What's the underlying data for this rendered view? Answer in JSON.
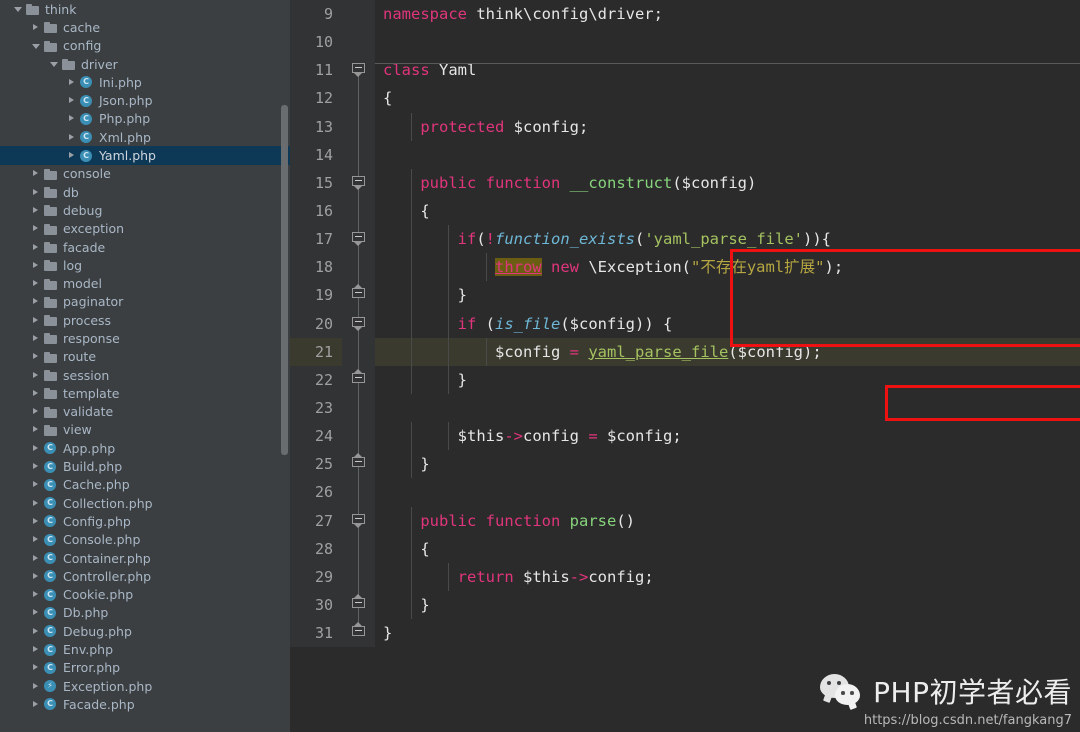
{
  "sidebar": {
    "scrollbar": "vertical-scrollbar",
    "items": [
      {
        "label": "think",
        "depth": 1,
        "type": "folder",
        "arrow": "open",
        "selected": false
      },
      {
        "label": "cache",
        "depth": 2,
        "type": "folder",
        "arrow": "closed",
        "selected": false
      },
      {
        "label": "config",
        "depth": 2,
        "type": "folder",
        "arrow": "open",
        "selected": false
      },
      {
        "label": "driver",
        "depth": 3,
        "type": "folder",
        "arrow": "open",
        "selected": false
      },
      {
        "label": "Ini.php",
        "depth": 4,
        "type": "class",
        "arrow": "closed",
        "selected": false
      },
      {
        "label": "Json.php",
        "depth": 4,
        "type": "class",
        "arrow": "closed",
        "selected": false
      },
      {
        "label": "Php.php",
        "depth": 4,
        "type": "class",
        "arrow": "closed",
        "selected": false
      },
      {
        "label": "Xml.php",
        "depth": 4,
        "type": "class",
        "arrow": "closed",
        "selected": false
      },
      {
        "label": "Yaml.php",
        "depth": 4,
        "type": "class",
        "arrow": "closed",
        "selected": true
      },
      {
        "label": "console",
        "depth": 2,
        "type": "folder",
        "arrow": "closed",
        "selected": false
      },
      {
        "label": "db",
        "depth": 2,
        "type": "folder",
        "arrow": "closed",
        "selected": false
      },
      {
        "label": "debug",
        "depth": 2,
        "type": "folder",
        "arrow": "closed",
        "selected": false
      },
      {
        "label": "exception",
        "depth": 2,
        "type": "folder",
        "arrow": "closed",
        "selected": false
      },
      {
        "label": "facade",
        "depth": 2,
        "type": "folder",
        "arrow": "closed",
        "selected": false
      },
      {
        "label": "log",
        "depth": 2,
        "type": "folder",
        "arrow": "closed",
        "selected": false
      },
      {
        "label": "model",
        "depth": 2,
        "type": "folder",
        "arrow": "closed",
        "selected": false
      },
      {
        "label": "paginator",
        "depth": 2,
        "type": "folder",
        "arrow": "closed",
        "selected": false
      },
      {
        "label": "process",
        "depth": 2,
        "type": "folder",
        "arrow": "closed",
        "selected": false
      },
      {
        "label": "response",
        "depth": 2,
        "type": "folder",
        "arrow": "closed",
        "selected": false
      },
      {
        "label": "route",
        "depth": 2,
        "type": "folder",
        "arrow": "closed",
        "selected": false
      },
      {
        "label": "session",
        "depth": 2,
        "type": "folder",
        "arrow": "closed",
        "selected": false
      },
      {
        "label": "template",
        "depth": 2,
        "type": "folder",
        "arrow": "closed",
        "selected": false
      },
      {
        "label": "validate",
        "depth": 2,
        "type": "folder",
        "arrow": "closed",
        "selected": false
      },
      {
        "label": "view",
        "depth": 2,
        "type": "folder",
        "arrow": "closed",
        "selected": false
      },
      {
        "label": "App.php",
        "depth": 2,
        "type": "class",
        "arrow": "closed",
        "selected": false
      },
      {
        "label": "Build.php",
        "depth": 2,
        "type": "class",
        "arrow": "closed",
        "selected": false
      },
      {
        "label": "Cache.php",
        "depth": 2,
        "type": "class",
        "arrow": "closed",
        "selected": false
      },
      {
        "label": "Collection.php",
        "depth": 2,
        "type": "class",
        "arrow": "closed",
        "selected": false
      },
      {
        "label": "Config.php",
        "depth": 2,
        "type": "class",
        "arrow": "closed",
        "selected": false
      },
      {
        "label": "Console.php",
        "depth": 2,
        "type": "class",
        "arrow": "closed",
        "selected": false
      },
      {
        "label": "Container.php",
        "depth": 2,
        "type": "class",
        "arrow": "closed",
        "selected": false
      },
      {
        "label": "Controller.php",
        "depth": 2,
        "type": "class",
        "arrow": "closed",
        "selected": false
      },
      {
        "label": "Cookie.php",
        "depth": 2,
        "type": "class",
        "arrow": "closed",
        "selected": false
      },
      {
        "label": "Db.php",
        "depth": 2,
        "type": "class",
        "arrow": "closed",
        "selected": false
      },
      {
        "label": "Debug.php",
        "depth": 2,
        "type": "class",
        "arrow": "closed",
        "selected": false
      },
      {
        "label": "Env.php",
        "depth": 2,
        "type": "class",
        "arrow": "closed",
        "selected": false
      },
      {
        "label": "Error.php",
        "depth": 2,
        "type": "class",
        "arrow": "closed",
        "selected": false
      },
      {
        "label": "Exception.php",
        "depth": 2,
        "type": "exception",
        "arrow": "closed",
        "selected": false
      },
      {
        "label": "Facade.php",
        "depth": 2,
        "type": "class",
        "arrow": "closed",
        "selected": false
      }
    ]
  },
  "editor": {
    "current_line": 21,
    "lines": [
      {
        "num": "9",
        "fold": "none",
        "vline": "none",
        "text": "namespace think\\config\\driver;"
      },
      {
        "num": "10",
        "fold": "none",
        "vline": "none",
        "text": ""
      },
      {
        "num": "11",
        "fold": "down",
        "vline": "half-bot",
        "text": "class Yaml"
      },
      {
        "num": "12",
        "fold": "none",
        "vline": "full",
        "text": "{"
      },
      {
        "num": "13",
        "fold": "none",
        "vline": "full",
        "text": "    protected $config;"
      },
      {
        "num": "14",
        "fold": "none",
        "vline": "full",
        "text": ""
      },
      {
        "num": "15",
        "fold": "down",
        "vline": "full",
        "text": "    public function __construct($config)"
      },
      {
        "num": "16",
        "fold": "none",
        "vline": "full",
        "text": "    {"
      },
      {
        "num": "17",
        "fold": "down",
        "vline": "full",
        "text": "        if(!function_exists('yaml_parse_file')){"
      },
      {
        "num": "18",
        "fold": "none",
        "vline": "full",
        "text": "            throw new \\Exception(\"不存在yaml扩展\");"
      },
      {
        "num": "19",
        "fold": "up",
        "vline": "full",
        "text": "        }"
      },
      {
        "num": "20",
        "fold": "down",
        "vline": "full",
        "text": "        if (is_file($config)) {"
      },
      {
        "num": "21",
        "fold": "none",
        "vline": "full",
        "text": "            $config = yaml_parse_file($config);"
      },
      {
        "num": "22",
        "fold": "up",
        "vline": "full",
        "text": "        }"
      },
      {
        "num": "23",
        "fold": "none",
        "vline": "full",
        "text": ""
      },
      {
        "num": "24",
        "fold": "none",
        "vline": "full",
        "text": "        $this->config = $config;"
      },
      {
        "num": "25",
        "fold": "up",
        "vline": "full",
        "text": "    }"
      },
      {
        "num": "26",
        "fold": "none",
        "vline": "full",
        "text": ""
      },
      {
        "num": "27",
        "fold": "down",
        "vline": "full",
        "text": "    public function parse()"
      },
      {
        "num": "28",
        "fold": "none",
        "vline": "full",
        "text": "    {"
      },
      {
        "num": "29",
        "fold": "none",
        "vline": "full",
        "text": "        return $this->config;"
      },
      {
        "num": "30",
        "fold": "up",
        "vline": "full",
        "text": "    }"
      },
      {
        "num": "31",
        "fold": "up",
        "vline": "half-top",
        "text": "}"
      }
    ],
    "annotations": [
      {
        "name": "red-highlight-box-exception-check",
        "color": "#ee1111"
      },
      {
        "name": "red-highlight-box-yaml-parse-file",
        "color": "#ee1111"
      }
    ]
  },
  "watermark": {
    "title": "PHP初学者必看",
    "url": "https://blog.csdn.net/fangkang7",
    "logo": "wechat-icon"
  },
  "colors": {
    "sidebar_bg": "#3c3f41",
    "editor_bg": "#2b2b2b",
    "gutter_bg": "#313335",
    "selection_bg": "#0d3856",
    "current_line_bg": "#3a3a2e",
    "accent_red": "#ee1111",
    "keyword_pink": "#e0357c",
    "string_green": "#a5c261",
    "function_blue": "#6fb7d6"
  }
}
